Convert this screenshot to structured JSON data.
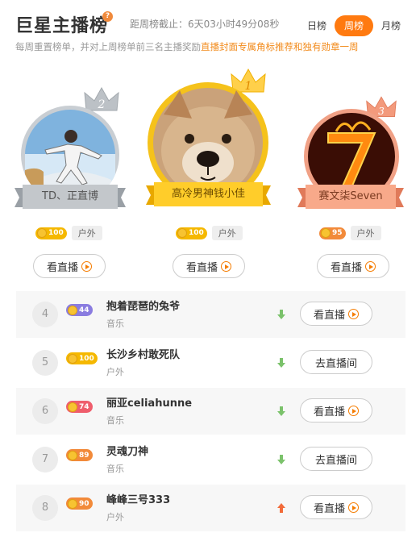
{
  "header": {
    "title": "巨星主播榜",
    "help_icon": "?",
    "countdown": "距周榜截止：6天03小时49分08秒",
    "tabs": [
      {
        "label": "日榜",
        "active": false
      },
      {
        "label": "周榜",
        "active": true
      },
      {
        "label": "月榜",
        "active": false
      }
    ],
    "subtitle_plain": "每周重置榜单，并对上周榜单前三名主播奖励",
    "subtitle_highlight": "直播封面专属角标推荐和独有勋章一周"
  },
  "colors": {
    "accent": "#ff7a10",
    "gold": "#f5b800",
    "silver": "#a9aeb4",
    "bronze": "#e9856a"
  },
  "podium": [
    {
      "rank": "2",
      "name": "TD、正直博",
      "level": "100",
      "tag": "户外",
      "button": "看直播",
      "avatar": "person-jumping-photo"
    },
    {
      "rank": "1",
      "name": "高冷男神钱小佳",
      "level": "100",
      "tag": "户外",
      "button": "看直播",
      "avatar": "dog-photo"
    },
    {
      "rank": "3",
      "name": "赛文柒Seven",
      "level": "95",
      "tag": "户外",
      "button": "看直播",
      "avatar": "fire-seven-photo"
    }
  ],
  "list": [
    {
      "rank": "4",
      "name": "抱着琵琶的兔爷",
      "category": "音乐",
      "level": "44",
      "level_color": "#8a7ce0",
      "trend": "down",
      "button": "看直播",
      "live": true
    },
    {
      "rank": "5",
      "name": "长沙乡村敢死队",
      "category": "户外",
      "level": "100",
      "level_color": "#f5b800",
      "trend": "down",
      "button": "去直播间",
      "live": false
    },
    {
      "rank": "6",
      "name": "丽亚celiahunne",
      "category": "音乐",
      "level": "74",
      "level_color": "#ef5d6c",
      "trend": "down",
      "button": "看直播",
      "live": true
    },
    {
      "rank": "7",
      "name": "灵魂刀神",
      "category": "音乐",
      "level": "89",
      "level_color": "#f28a3a",
      "trend": "down",
      "button": "去直播间",
      "live": false
    },
    {
      "rank": "8",
      "name": "峰峰三号333",
      "category": "户外",
      "level": "90",
      "level_color": "#f28a3a",
      "trend": "up",
      "button": "看直播",
      "live": true
    }
  ]
}
